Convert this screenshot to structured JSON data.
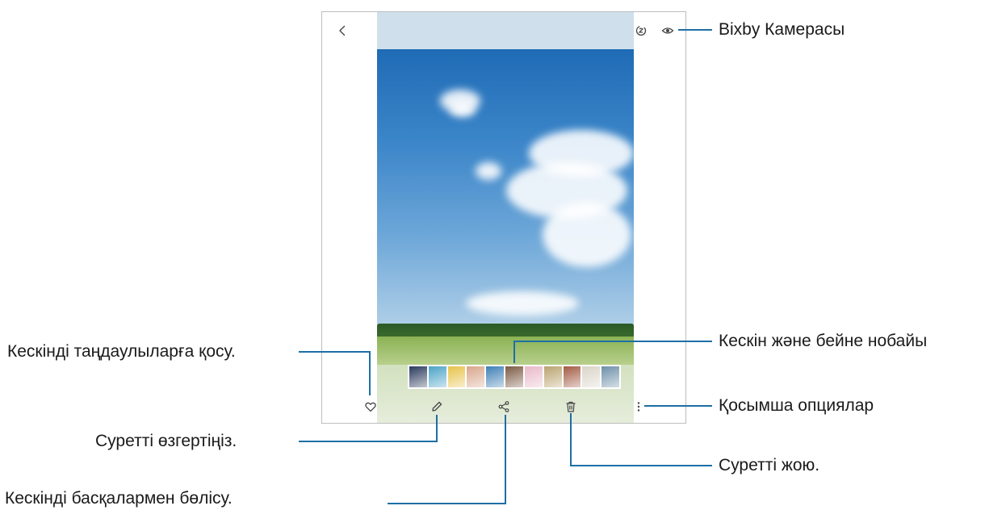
{
  "callouts": {
    "bixby_camera": "Bixby Камерасы",
    "thumbnails": "Кескін және бейне нобайы",
    "more_options": "Қосымша опциялар",
    "delete_image": "Суретті жою.",
    "add_to_favorites": "Кескінді таңдаулыларға қосу.",
    "edit_image": "Суретті өзгертіңіз.",
    "share_image": "Кескінді басқалармен бөлісу."
  },
  "icons": {
    "back": "chevron-left-icon",
    "bixby": "bixby-vision-icon",
    "view": "eye-icon",
    "favorite": "heart-icon",
    "edit": "pencil-icon",
    "share": "share-icon",
    "delete": "trash-icon",
    "more": "more-vertical-icon"
  },
  "colors": {
    "callout_line": "#1d6fa5",
    "icon": "#444444"
  },
  "filmstrip": {
    "thumbnail_colors": [
      "#2a3a5c",
      "#4aa3c7",
      "#e7c24a",
      "#d8a58c",
      "#3d7fb5",
      "#7c5a44",
      "#e8b8c8",
      "#b9a36e",
      "#a35a44",
      "#d9d4c8",
      "#6d8fa8"
    ]
  }
}
